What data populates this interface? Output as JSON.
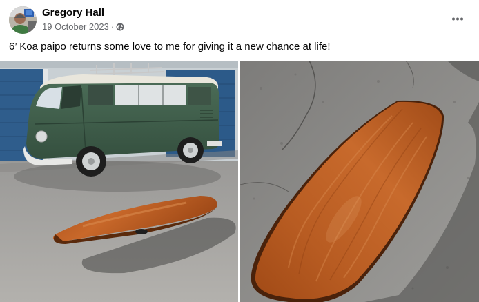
{
  "post": {
    "author": "Gregory Hall",
    "date": "19 October 2023",
    "separator": "·",
    "audience_icon": "globe-icon",
    "more_icon": "more-options-icon",
    "text": "6’ Koa paipo returns some love to me for giving it a new chance at life!"
  },
  "photos": [
    {
      "name": "photo-paipo-with-vw-bus",
      "subject": "green VW bus with wooden paipo board"
    },
    {
      "name": "photo-paipo-closeup",
      "subject": "close-up of wooden paipo board on asphalt"
    }
  ],
  "colors": {
    "name_text": "#050505",
    "secondary_text": "#65676b",
    "van_green": "#3f5f4b",
    "koa_wood": "#b8581f",
    "asphalt": "#8d8c8a"
  }
}
